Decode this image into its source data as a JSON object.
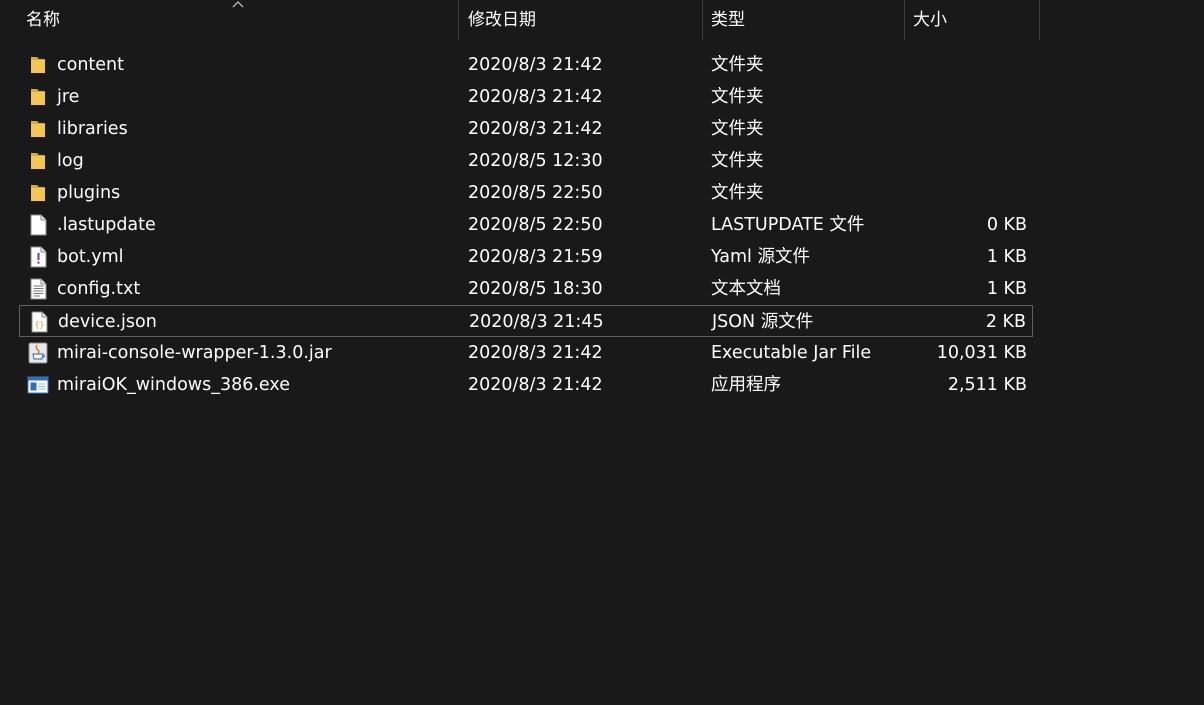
{
  "columns": {
    "name": "名称",
    "date": "修改日期",
    "type": "类型",
    "size": "大小"
  },
  "sort": {
    "column": "name",
    "indicator": "caret-up-icon"
  },
  "files": [
    {
      "name": "content",
      "date": "2020/8/3 21:42",
      "type": "文件夹",
      "size": "",
      "icon": "folder-icon"
    },
    {
      "name": "jre",
      "date": "2020/8/3 21:42",
      "type": "文件夹",
      "size": "",
      "icon": "folder-icon"
    },
    {
      "name": "libraries",
      "date": "2020/8/3 21:42",
      "type": "文件夹",
      "size": "",
      "icon": "folder-icon"
    },
    {
      "name": "log",
      "date": "2020/8/5 12:30",
      "type": "文件夹",
      "size": "",
      "icon": "folder-icon"
    },
    {
      "name": "plugins",
      "date": "2020/8/5 22:50",
      "type": "文件夹",
      "size": "",
      "icon": "folder-icon"
    },
    {
      "name": ".lastupdate",
      "date": "2020/8/5 22:50",
      "type": "LASTUPDATE 文件",
      "size": "0 KB",
      "icon": "blank-file-icon"
    },
    {
      "name": "bot.yml",
      "date": "2020/8/3 21:59",
      "type": "Yaml 源文件",
      "size": "1 KB",
      "icon": "yaml-file-icon"
    },
    {
      "name": "config.txt",
      "date": "2020/8/5 18:30",
      "type": "文本文档",
      "size": "1 KB",
      "icon": "text-file-icon"
    },
    {
      "name": "device.json",
      "date": "2020/8/3 21:45",
      "type": "JSON 源文件",
      "size": "2 KB",
      "icon": "json-file-icon",
      "focused": true
    },
    {
      "name": "mirai-console-wrapper-1.3.0.jar",
      "date": "2020/8/3 21:42",
      "type": "Executable Jar File",
      "size": "10,031 KB",
      "icon": "java-jar-icon"
    },
    {
      "name": "miraiOK_windows_386.exe",
      "date": "2020/8/3 21:42",
      "type": "应用程序",
      "size": "2,511 KB",
      "icon": "exe-app-icon"
    }
  ],
  "colors": {
    "background": "#191919",
    "text": "#ffffff",
    "folder": "#f3c64f",
    "focus_border": "#5e5e5e"
  }
}
